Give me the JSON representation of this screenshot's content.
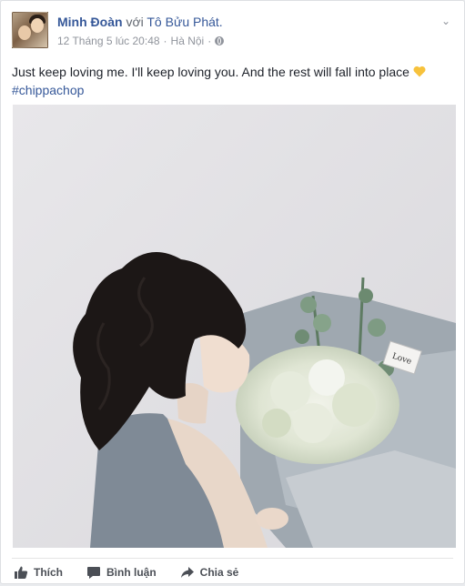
{
  "post": {
    "author": "Minh Đoàn",
    "with_word": "với",
    "tagged": "Tô Bửu Phát.",
    "timestamp": "12 Tháng 5 lúc 20:48",
    "location": "Hà Nội",
    "separator": "·",
    "text": "Just keep loving me. I'll keep loving you. And the rest will fall into place",
    "hashtag": "#chippachop",
    "photo_tag_text": "Love"
  },
  "actions": {
    "like_label": "Thích",
    "comment_label": "Bình luận",
    "share_label": "Chia sẻ"
  },
  "colors": {
    "link": "#365899",
    "heart": "#f7c23c",
    "meta": "#90949c"
  }
}
